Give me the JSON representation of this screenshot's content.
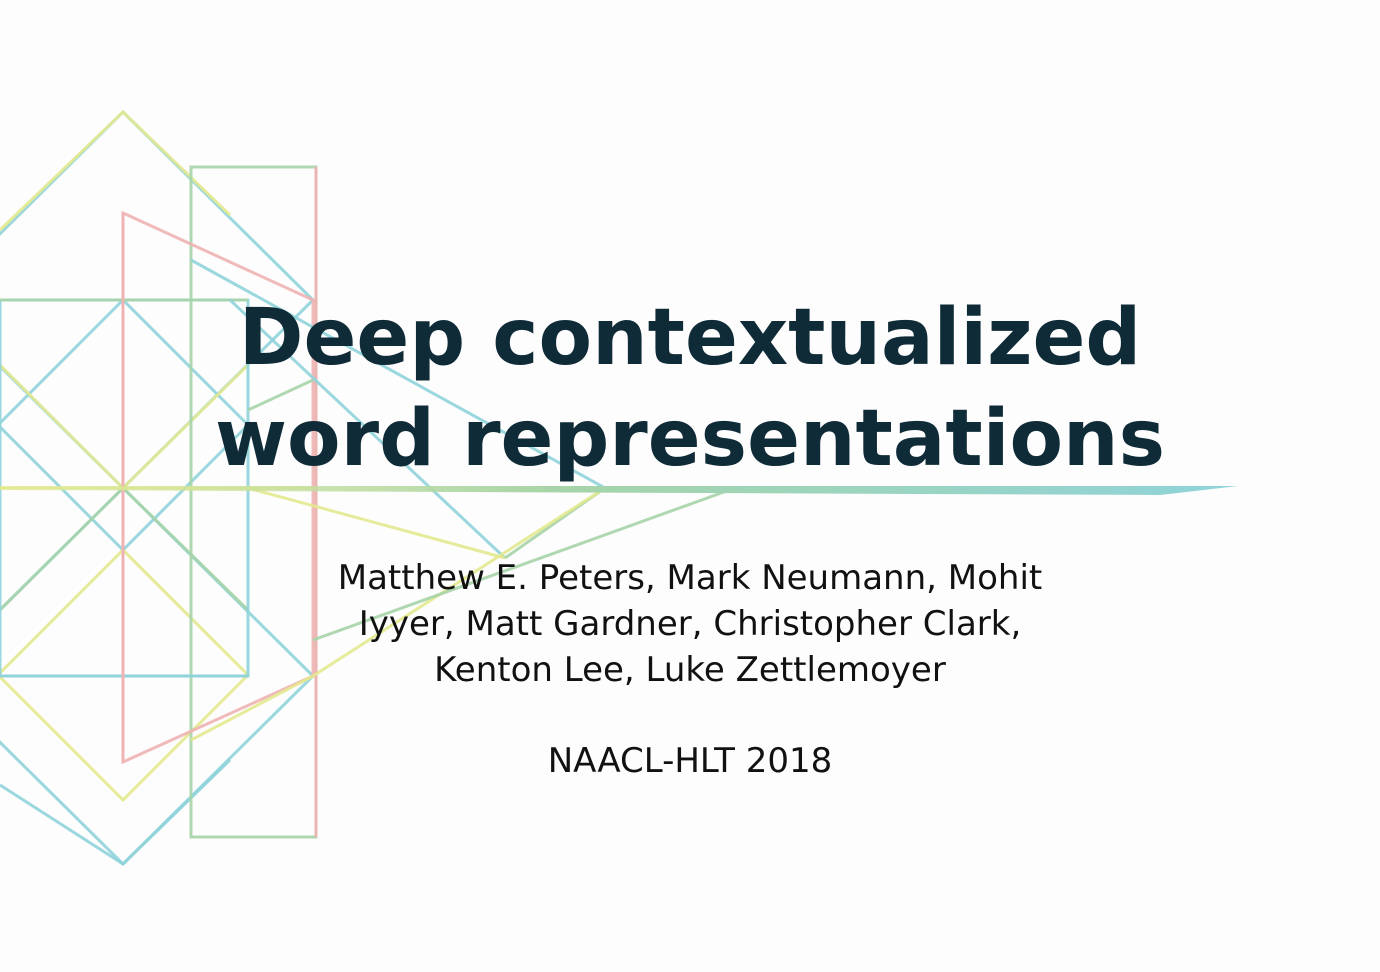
{
  "slide": {
    "title_lines": [
      "Deep contextualized",
      "word representations"
    ],
    "author_lines": [
      "Matthew E. Peters, Mark Neumann, Mohit",
      "Iyyer, Matt Gardner, Christopher Clark,",
      "Kenton Lee, Luke Zettlemoyer"
    ],
    "venue": "NAACL-HLT 2018"
  },
  "colors": {
    "background": "#fdfdfd",
    "title": "#0f2b38",
    "text": "#111111",
    "line_blue": "#8fd3da",
    "line_green": "#a6d4a8",
    "line_yellow": "#e3e98f",
    "line_pink": "#efb3b3"
  }
}
